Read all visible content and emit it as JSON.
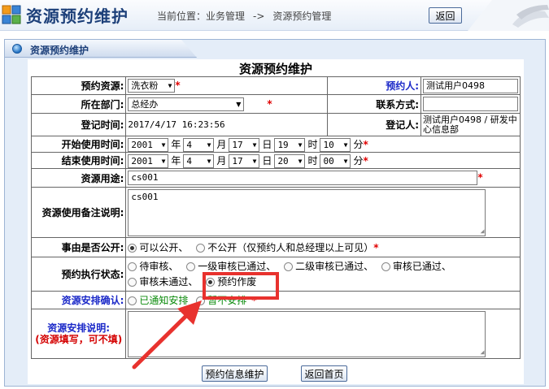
{
  "header": {
    "title": "资源预约维护",
    "breadcrumb_prefix": "当前位置：",
    "breadcrumb_section": "业务管理",
    "breadcrumb_sep": "->",
    "breadcrumb_page": "资源预约管理",
    "back_label": "返回"
  },
  "panel": {
    "tab_label": "资源预约维护",
    "form_title": "资源预约维护"
  },
  "form": {
    "resource_label": "预约资源:",
    "resource_value": "洗衣粉",
    "booker_label": "预约人:",
    "booker_value": "测试用户0498",
    "dept_label": "所在部门:",
    "dept_value": "总经办",
    "contact_label": "联系方式:",
    "contact_value": "",
    "reg_time_label": "登记时间:",
    "reg_time_value": "2017/4/17 16:23:56",
    "registrar_label": "登记人:",
    "registrar_value": "测试用户0498 / 研发中心信息部",
    "start_label": "开始使用时间:",
    "start": {
      "year": "2001",
      "month": "4",
      "day": "17",
      "hour": "19",
      "minute": "10"
    },
    "end_label": "结束使用时间:",
    "end": {
      "year": "2001",
      "month": "4",
      "day": "17",
      "hour": "20",
      "minute": "00"
    },
    "units": {
      "year": "年",
      "month": "月",
      "day": "日",
      "hour": "时",
      "minute": "分"
    },
    "purpose_label": "资源用途:",
    "purpose_value": "cs001",
    "remark_label": "资源使用备注说明:",
    "remark_value": "cs001",
    "public_label": "事由是否公开:",
    "public_options": [
      "可以公开、",
      "不公开（仅预约人和总经理以上可见）"
    ],
    "status_label": "预约执行状态:",
    "status_options": [
      "待审核、",
      "一级审核已通过、",
      "二级审核已通过、",
      "审核已通过、",
      "审核未通过、",
      "预约作废"
    ],
    "arrange_label": "资源安排确认:",
    "arrange_options": [
      "已通知安排",
      "暂不安排"
    ],
    "arrange_note_label": "资源安排说明:",
    "arrange_note_sub": "(资源填写，可不填)",
    "arrange_note_value": "",
    "required_mark": "*"
  },
  "buttons": {
    "save_label": "预约信息维护",
    "home_label": "返回首页"
  },
  "colors": {
    "required": "#e00000",
    "highlight": "#e8322e",
    "label_blue": "#1a28c8",
    "option_green": "#0a8a0a"
  }
}
